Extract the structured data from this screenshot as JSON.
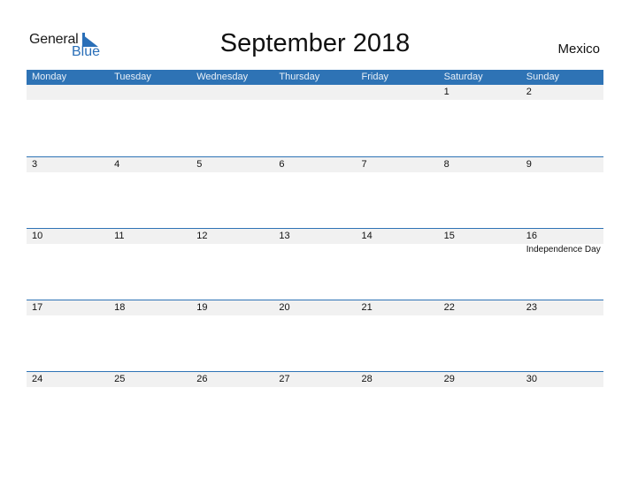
{
  "logo": {
    "word1": "General",
    "word2": "Blue"
  },
  "title": "September 2018",
  "country": "Mexico",
  "colors": {
    "accent": "#2e73b5",
    "strip": "#f1f1f1"
  },
  "weekdays": [
    "Monday",
    "Tuesday",
    "Wednesday",
    "Thursday",
    "Friday",
    "Saturday",
    "Sunday"
  ],
  "weeks": [
    {
      "days": [
        "",
        "",
        "",
        "",
        "",
        "1",
        "2"
      ],
      "events": [
        "",
        "",
        "",
        "",
        "",
        "",
        ""
      ]
    },
    {
      "days": [
        "3",
        "4",
        "5",
        "6",
        "7",
        "8",
        "9"
      ],
      "events": [
        "",
        "",
        "",
        "",
        "",
        "",
        ""
      ]
    },
    {
      "days": [
        "10",
        "11",
        "12",
        "13",
        "14",
        "15",
        "16"
      ],
      "events": [
        "",
        "",
        "",
        "",
        "",
        "",
        "Independence Day"
      ]
    },
    {
      "days": [
        "17",
        "18",
        "19",
        "20",
        "21",
        "22",
        "23"
      ],
      "events": [
        "",
        "",
        "",
        "",
        "",
        "",
        ""
      ]
    },
    {
      "days": [
        "24",
        "25",
        "26",
        "27",
        "28",
        "29",
        "30"
      ],
      "events": [
        "",
        "",
        "",
        "",
        "",
        "",
        ""
      ]
    }
  ]
}
